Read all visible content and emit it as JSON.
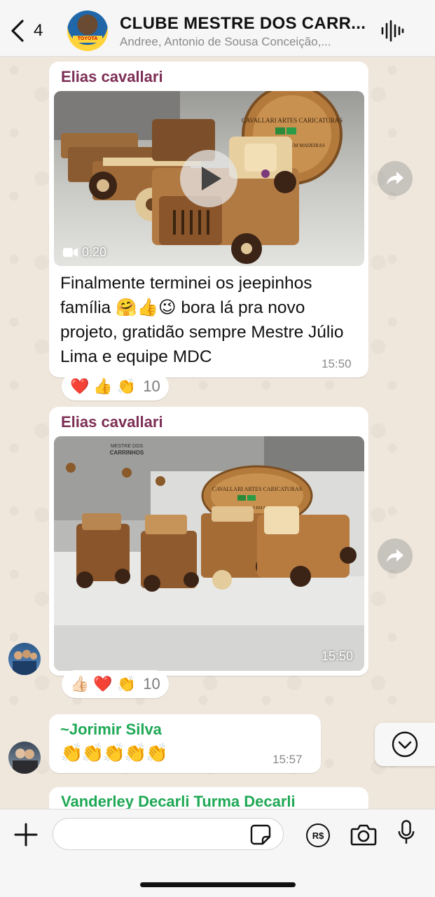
{
  "header": {
    "back_count": "4",
    "title": "CLUBE MESTRE DOS CARR...",
    "members": "Andree, Antonio de Sousa Conceição,...",
    "avatar_label": "TOYOTA"
  },
  "messages": [
    {
      "sender": "Elias cavallari",
      "sender_color": "#7d2e55",
      "type": "video",
      "duration": "0:20",
      "media_art": {
        "plaque_lines": [
          "CAVALLARI ARTES CARICATURAS",
          "MINIATURAS EM MADEIRAS"
        ]
      },
      "text": "Finalmente terminei os jeepinhos família 🤗👍😉 bora lá pra novo projeto, gratidão sempre Mestre Júlio Lima e equipe MDC",
      "time": "15:50",
      "reactions": [
        "❤️",
        "👍",
        "👏"
      ],
      "reaction_count": "10"
    },
    {
      "sender": "Elias cavallari",
      "sender_color": "#7d2e55",
      "type": "image",
      "media_art": {
        "sticker_lines": [
          "MESTRE DOS",
          "CARRINHOS"
        ],
        "plaque_lines": [
          "CAVALLARI ARTES CARICATURAS",
          "MINIATURAS EM MADEIRAS"
        ]
      },
      "time": "15:50",
      "reactions": [
        "👍🏻",
        "❤️",
        "👏"
      ],
      "reaction_count": "10"
    },
    {
      "sender": "~Jorimir Silva",
      "sender_color": "#1fa855",
      "type": "text",
      "text": "👏👏👏👏👏",
      "time": "15:57"
    },
    {
      "sender": "Vanderley Decarli Turma Decarli",
      "sender_color": "#1fa855",
      "type": "partial"
    }
  ],
  "input": {
    "placeholder": "",
    "currency_label": "R$"
  }
}
